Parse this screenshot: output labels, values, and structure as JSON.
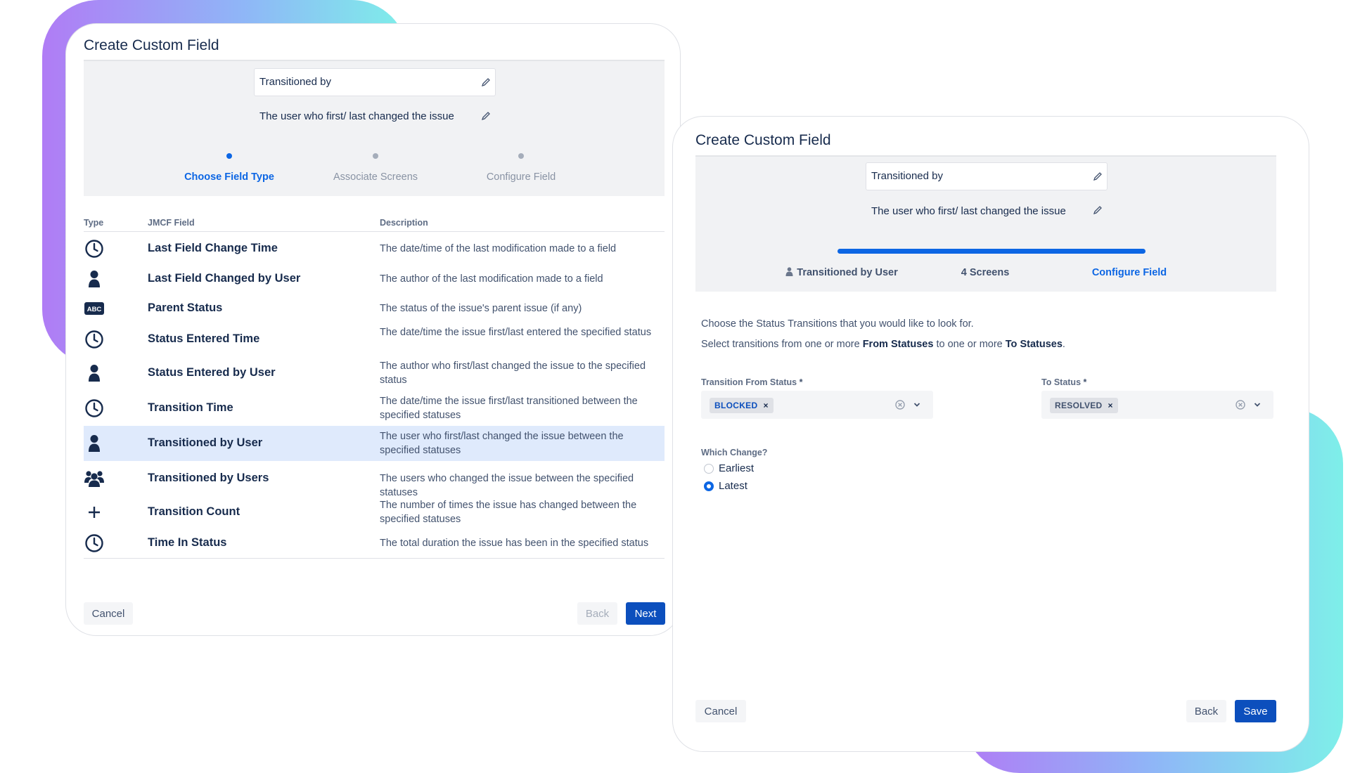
{
  "left_dialog": {
    "title": "Create Custom Field",
    "name_value": "Transitioned by",
    "description_value": "The user who first/ last changed the issue",
    "steps": [
      "Choose Field Type",
      "Associate Screens",
      "Configure Field"
    ],
    "columns": {
      "type": "Type",
      "field": "JMCF Field",
      "description": "Description"
    },
    "rows": [
      {
        "icon": "clock-icon",
        "name": "Last Field Change Time",
        "description": "The date/time of the last modification made to a field"
      },
      {
        "icon": "user-icon",
        "name": "Last Field Changed by User",
        "description": "The author of the last modification made to a field"
      },
      {
        "icon": "abc-icon",
        "name": "Parent Status",
        "description": "The status of the issue's parent issue (if any)"
      },
      {
        "icon": "clock-icon",
        "name": "Status Entered Time",
        "description": "The date/time the issue first/last entered the specified status"
      },
      {
        "icon": "user-icon",
        "name": "Status Entered by User",
        "description": "The author who first/last changed the issue to the specified status"
      },
      {
        "icon": "clock-icon",
        "name": "Transition Time",
        "description": "The date/time the issue first/last transitioned between the specified statuses"
      },
      {
        "icon": "user-icon",
        "name": "Transitioned by User",
        "description": "The user who first/last changed the issue between the specified statuses",
        "selected": true
      },
      {
        "icon": "users-icon",
        "name": "Transitioned by Users",
        "description": "The users who changed the issue between the specified statuses"
      },
      {
        "icon": "plus-icon",
        "name": "Transition Count",
        "description": "The number of times the issue has changed between the specified statuses"
      },
      {
        "icon": "clock-icon",
        "name": "Time In Status",
        "description": "The total duration the issue has been in the specified status"
      }
    ],
    "buttons": {
      "cancel": "Cancel",
      "back": "Back",
      "next": "Next"
    }
  },
  "right_dialog": {
    "title": "Create Custom Field",
    "name_value": "Transitioned by",
    "description_value": "The user who first/ last changed the issue",
    "progress": 1.0,
    "steps": [
      "Transitioned by User",
      "4 Screens",
      "Configure Field"
    ],
    "intro_line1": "Choose the Status Transitions that you would like to look for.",
    "intro_line2_parts": [
      "Select transitions from one or more ",
      "From Statuses",
      " to one or more ",
      "To Statuses",
      "."
    ],
    "from_status": {
      "label": "Transition From Status",
      "required": "*",
      "tag": "BLOCKED",
      "tag_x": "×"
    },
    "to_status": {
      "label": "To Status",
      "required": "*",
      "tag": "RESOLVED",
      "tag_x": "×"
    },
    "which_change": {
      "label": "Which Change?",
      "options": [
        "Earliest",
        "Latest"
      ],
      "selected": "Latest"
    },
    "buttons": {
      "cancel": "Cancel",
      "back": "Back",
      "save": "Save"
    }
  },
  "colors": {
    "primary": "#0c4fbd",
    "link": "#0c66e4",
    "selected_row": "#dfeafc",
    "header_bg": "#f1f2f4"
  }
}
